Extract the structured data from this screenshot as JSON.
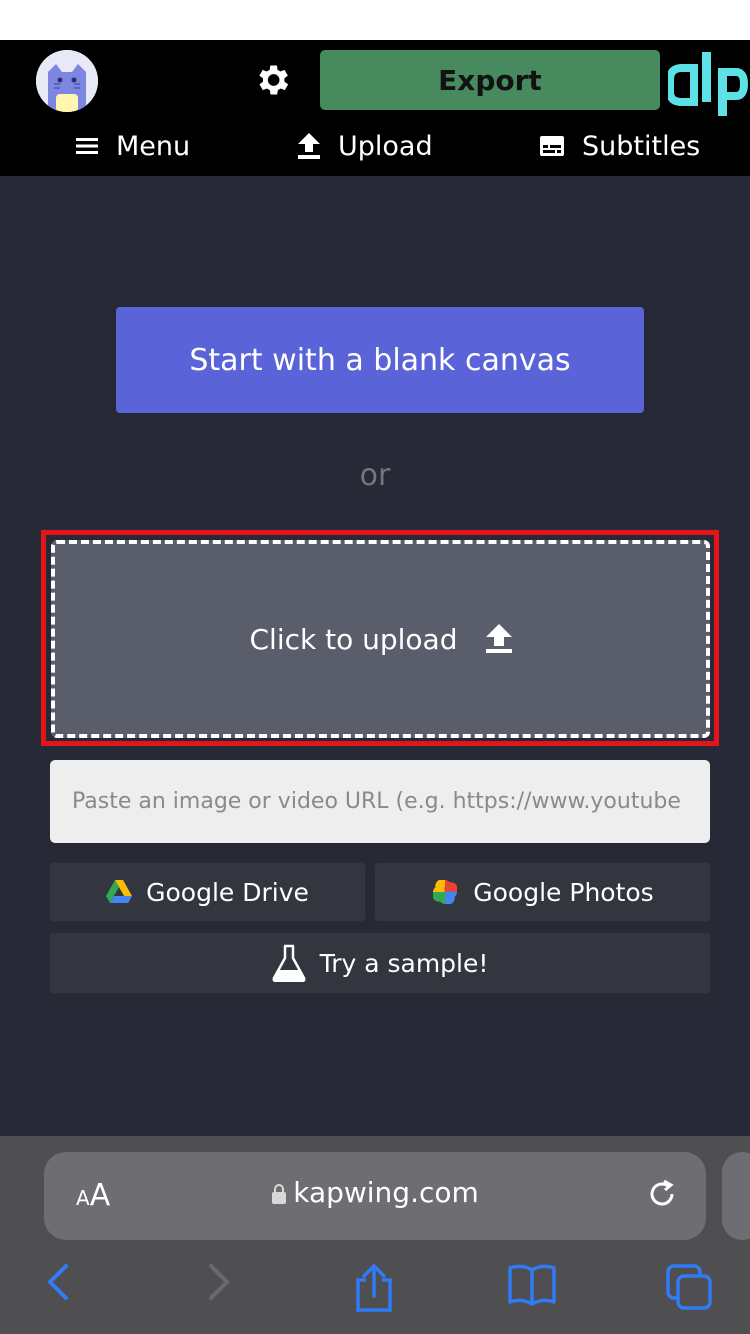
{
  "toolbar": {
    "export_label": "Export",
    "menu_label": "Menu",
    "upload_label": "Upload",
    "subtitles_label": "Subtitles"
  },
  "main": {
    "blank_canvas_label": "Start with a blank canvas",
    "or_label": "or",
    "click_upload_label": "Click to upload",
    "url_placeholder": "Paste an image or video URL (e.g. https://www.youtube",
    "google_drive_label": "Google Drive",
    "google_photos_label": "Google Photos",
    "sample_label": "Try a sample!"
  },
  "browser": {
    "aa_small": "A",
    "aa_big": "A",
    "domain": "kapwing.com"
  },
  "colors": {
    "export_green": "#468a5e",
    "blank_canvas_blue": "#5b63d9",
    "highlight_red": "#e3141a",
    "logo_cyan": "#5ce1e6",
    "ios_blue": "#2f7cf6"
  },
  "icons": [
    "cat-avatar-icon",
    "gear-icon",
    "logo-icon",
    "hamburger-icon",
    "upload-icon",
    "subtitles-icon",
    "google-drive-icon",
    "google-photos-icon",
    "flask-icon",
    "lock-icon",
    "reload-icon",
    "back-icon",
    "forward-icon",
    "share-icon",
    "bookmarks-icon",
    "tabs-icon"
  ]
}
